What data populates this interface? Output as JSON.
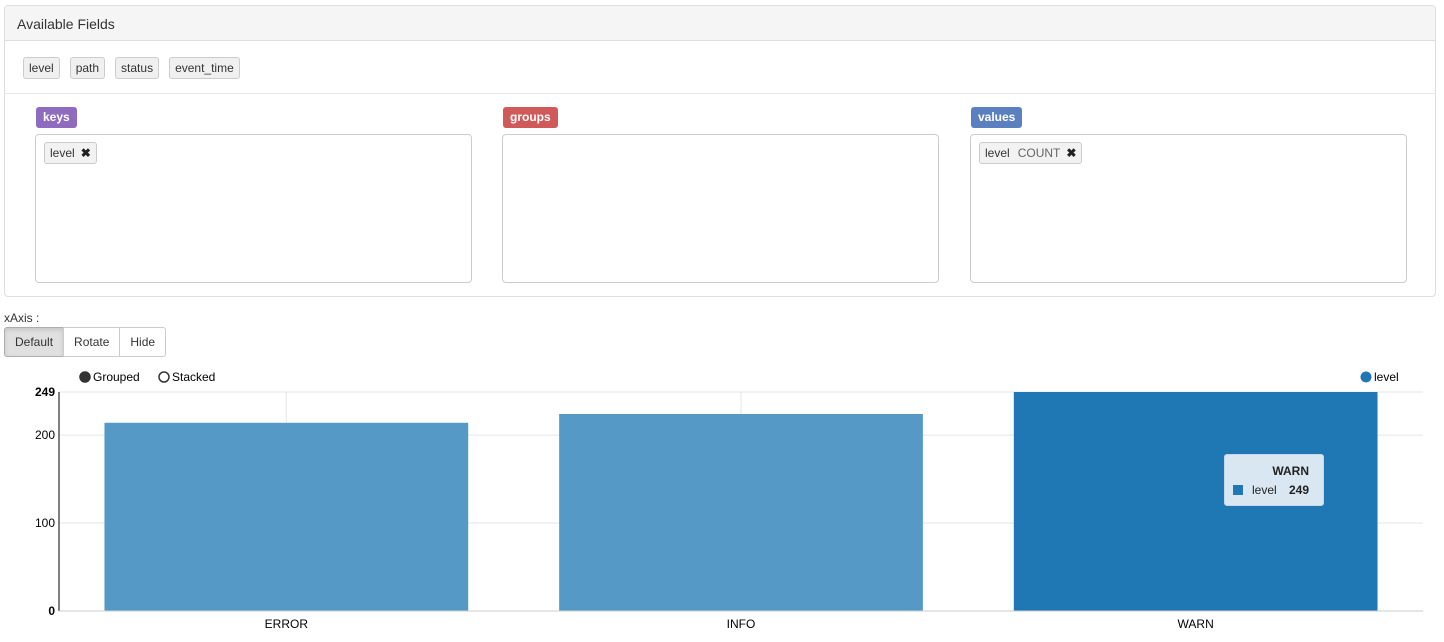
{
  "panel": {
    "title": "Available Fields"
  },
  "fields": [
    "level",
    "path",
    "status",
    "event_time"
  ],
  "zones": {
    "keys": {
      "label": "keys",
      "color": "#8e6bbf",
      "tag": {
        "name": "level",
        "remove": "✖"
      }
    },
    "groups": {
      "label": "groups",
      "color": "#d05a5a"
    },
    "values": {
      "label": "values",
      "color": "#5b80c0",
      "tag": {
        "name": "level",
        "agg": "COUNT",
        "remove": "✖"
      }
    }
  },
  "xaxis_controls": {
    "label": "xAxis :",
    "options": [
      "Default",
      "Rotate",
      "Hide"
    ],
    "selected": "Default"
  },
  "mode_controls": {
    "options": [
      {
        "label": "Grouped",
        "selected": true
      },
      {
        "label": "Stacked",
        "selected": false
      }
    ]
  },
  "chart_data": {
    "type": "bar",
    "categories": [
      "ERROR",
      "INFO",
      "WARN"
    ],
    "series": [
      {
        "name": "level",
        "values": [
          214,
          224,
          249
        ]
      }
    ],
    "ylim": [
      0,
      249
    ],
    "yticks": [
      0,
      100,
      200,
      249
    ],
    "grid": true,
    "legend": "top-right",
    "highlighted": "WARN",
    "colors": {
      "bar": "#5599c7",
      "highlight": "#1f77b4",
      "legend": "#1f77b4"
    }
  },
  "tooltip": {
    "title": "WARN",
    "series": "level",
    "value": "249"
  }
}
